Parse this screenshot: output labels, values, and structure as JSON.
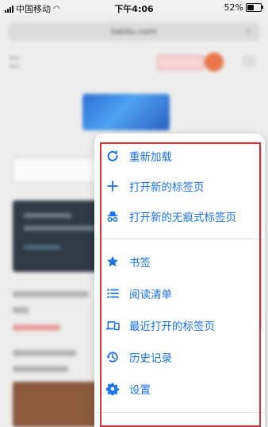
{
  "status_bar": {
    "carrier": "中国移动",
    "time": "下午4:06",
    "battery": "52%",
    "battery_level": 0.52
  },
  "browser": {
    "url": "baidu.com"
  },
  "menu": {
    "items": [
      {
        "label": "重新加载",
        "icon": "reload-icon"
      },
      {
        "label": "打开新的标签页",
        "icon": "plus-icon"
      },
      {
        "label": "打开新的无痕式标签页",
        "icon": "incognito-icon"
      },
      {
        "label": "书签",
        "icon": "star-icon"
      },
      {
        "label": "阅读清单",
        "icon": "list-icon"
      },
      {
        "label": "最近打开的标签页",
        "icon": "devices-icon"
      },
      {
        "label": "历史记录",
        "icon": "history-icon"
      },
      {
        "label": "设置",
        "icon": "gear-icon"
      }
    ]
  },
  "colors": {
    "accent": "#1a73e8",
    "highlight": "#d9313a"
  }
}
